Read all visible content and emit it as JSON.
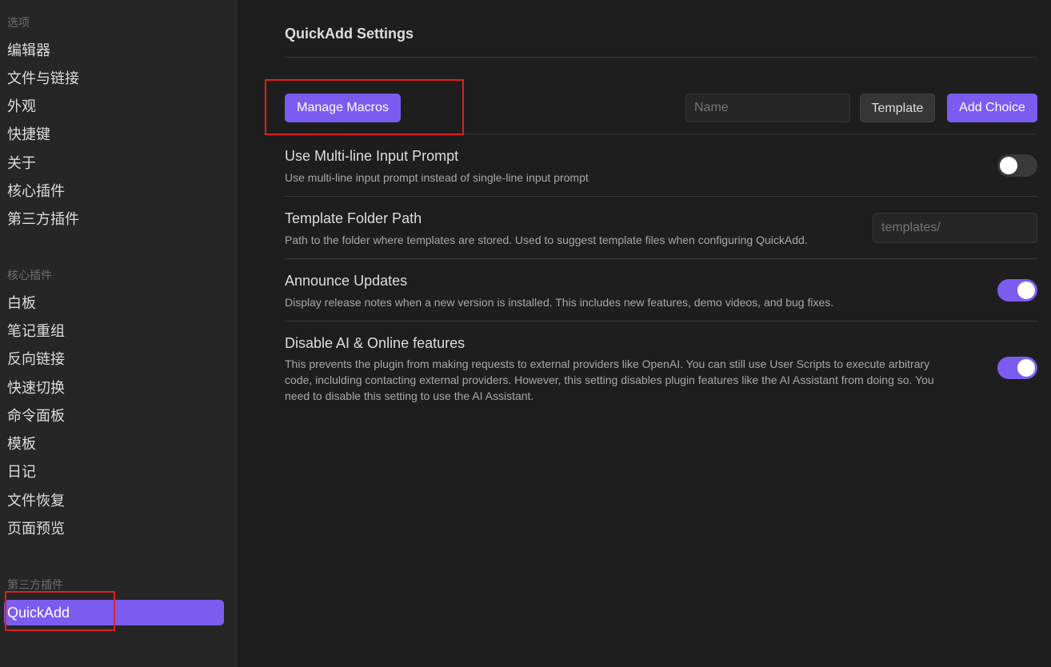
{
  "sidebar": {
    "groups": [
      {
        "title": "选项",
        "items": [
          "编辑器",
          "文件与链接",
          "外观",
          "快捷键",
          "关于",
          "核心插件",
          "第三方插件"
        ]
      },
      {
        "title": "核心插件",
        "items": [
          "白板",
          "笔记重组",
          "反向链接",
          "快速切换",
          "命令面板",
          "模板",
          "日记",
          "文件恢复",
          "页面预览"
        ]
      },
      {
        "title": "第三方插件",
        "items": [
          "QuickAdd"
        ]
      }
    ]
  },
  "main": {
    "title": "QuickAdd Settings",
    "toolbar": {
      "manage_macros": "Manage Macros",
      "name_placeholder": "Name",
      "template_button": "Template",
      "add_choice_button": "Add Choice"
    },
    "settings": [
      {
        "name": "Use Multi-line Input Prompt",
        "desc": "Use multi-line input prompt instead of single-line input prompt",
        "control": "toggle",
        "enabled": false
      },
      {
        "name": "Template Folder Path",
        "desc": "Path to the folder where templates are stored. Used to suggest template files when configuring QuickAdd.",
        "control": "text",
        "placeholder": "templates/"
      },
      {
        "name": "Announce Updates",
        "desc": "Display release notes when a new version is installed. This includes new features, demo videos, and bug fixes.",
        "control": "toggle",
        "enabled": true
      },
      {
        "name": "Disable AI & Online features",
        "desc_lines": [
          "This prevents the plugin from making requests to external providers like OpenAI. You can still use User Scripts to execute arbitrary",
          "code, inclulding contacting external providers. However, this setting disables plugin features like the AI Assistant from doing so. You",
          "need to disable this setting to use the AI Assistant."
        ],
        "control": "toggle",
        "enabled": true
      }
    ]
  },
  "colors": {
    "accent": "#7b5cf0",
    "background": "#1e1e1e",
    "sidebar": "#262626",
    "highlight": "#e02020"
  }
}
